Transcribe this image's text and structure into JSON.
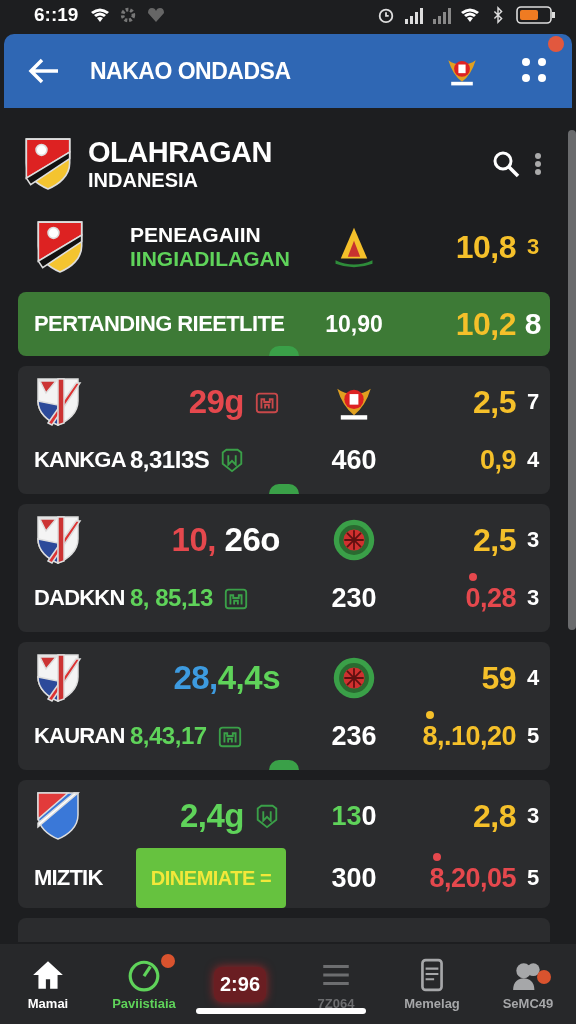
{
  "status_bar": {
    "time": "6::19"
  },
  "app_bar": {
    "title": "NAKAO ONDADSA"
  },
  "header": {
    "title": "OLAHRAGAN",
    "subtitle": "INDANESIA"
  },
  "featured": {
    "title": "PENEAGAIIN",
    "subtitle": "IINGIADILAGAN",
    "value": "10,8",
    "rank": "3"
  },
  "highlight": {
    "title": "PERTANDING RIEETLITE",
    "middle": "10,90",
    "value": "10,2",
    "rank": "8"
  },
  "matches": [
    {
      "crest": {
        "kind": "stripes"
      },
      "score": [
        {
          "text": "29g",
          "color": "#e5484d"
        }
      ],
      "score_icon": {
        "kind": "castle",
        "color": "#c9484a"
      },
      "emblem": {
        "kind": "garuda"
      },
      "value": [
        {
          "text": "2,5",
          "color": "#f5c02a"
        }
      ],
      "rank": "7",
      "name": "KANKGA",
      "stat": [
        {
          "text": "8,31I3S",
          "color": "#ffffff"
        }
      ],
      "stat_icon": {
        "kind": "shield",
        "color": "#3aa048"
      },
      "count": [
        {
          "text": "460",
          "color": "#ffffff"
        }
      ],
      "value2": [
        {
          "text": "0,9",
          "color": "#f5c02a"
        }
      ],
      "dot": false,
      "rank2": "4",
      "handle": true
    },
    {
      "crest": {
        "kind": "stripes"
      },
      "score": [
        {
          "text": "10,",
          "color": "#e5484d"
        },
        {
          "text": " 26o",
          "color": "#ffffff"
        }
      ],
      "emblem": {
        "kind": "wheel"
      },
      "value": [
        {
          "text": "2,5",
          "color": "#f5c02a"
        }
      ],
      "rank": "3",
      "name": "DADKKN",
      "stat": [
        {
          "text": "8, 85,13",
          "color": "#5fd35a"
        }
      ],
      "stat_icon": {
        "kind": "castle",
        "color": "#3aa048"
      },
      "count": [
        {
          "text": "230",
          "color": "#ffffff"
        }
      ],
      "value2": [
        {
          "text": "0,28",
          "color": "#e5484d"
        }
      ],
      "dot": true,
      "rank2": "3",
      "handle": false
    },
    {
      "crest": {
        "kind": "stripes"
      },
      "score": [
        {
          "text": "28,",
          "color": "#3d9be0"
        },
        {
          "text": "4,4s",
          "color": "#5fd35a"
        }
      ],
      "emblem": {
        "kind": "wheel"
      },
      "value": [
        {
          "text": "59",
          "color": "#f5c02a"
        }
      ],
      "rank": "4",
      "name": "KAURAN",
      "stat": [
        {
          "text": "8,43,17",
          "color": "#5fd35a"
        }
      ],
      "stat_icon": {
        "kind": "castle",
        "color": "#3aa048"
      },
      "count": [
        {
          "text": "236",
          "color": "#ffffff"
        }
      ],
      "value2": [
        {
          "text": "8,.10,20",
          "color": "#f5c02a"
        }
      ],
      "dot": true,
      "rank2": "5",
      "handle": true
    },
    {
      "crest": {
        "kind": "diagonal"
      },
      "score": [
        {
          "text": "2,4g",
          "color": "#5fd35a"
        }
      ],
      "score_icon": {
        "kind": "shield",
        "color": "#3aa048"
      },
      "middle": [
        {
          "text": "13",
          "color": "#5fd35a"
        },
        {
          "text": "0",
          "color": "#ffffff"
        }
      ],
      "value": [
        {
          "text": "2,8",
          "color": "#f5c02a"
        }
      ],
      "rank": "3",
      "name": "MIZTIK",
      "button": "DINEMIATE =",
      "count": [
        {
          "text": "300",
          "color": "#ffffff"
        }
      ],
      "value2": [
        {
          "text": "8,20,05",
          "color": "#e5484d"
        }
      ],
      "dot": true,
      "rank2": "5",
      "handle": false
    }
  ],
  "bottom_nav": [
    {
      "kind": "home",
      "label": "Mamai",
      "color": "#ffffff"
    },
    {
      "kind": "stopwatch",
      "label": "Paviistiaia",
      "color": "#5fd35a"
    },
    {
      "kind": "counter",
      "label": "2:96",
      "color": "#6a1e22"
    },
    {
      "kind": "lines",
      "label": "7Z064",
      "color": "#6d6e70"
    },
    {
      "kind": "phone",
      "label": "Memelag",
      "color": "#a6a7a9"
    },
    {
      "kind": "people",
      "label": "SeMC49",
      "color": "#a6a7a9"
    }
  ]
}
